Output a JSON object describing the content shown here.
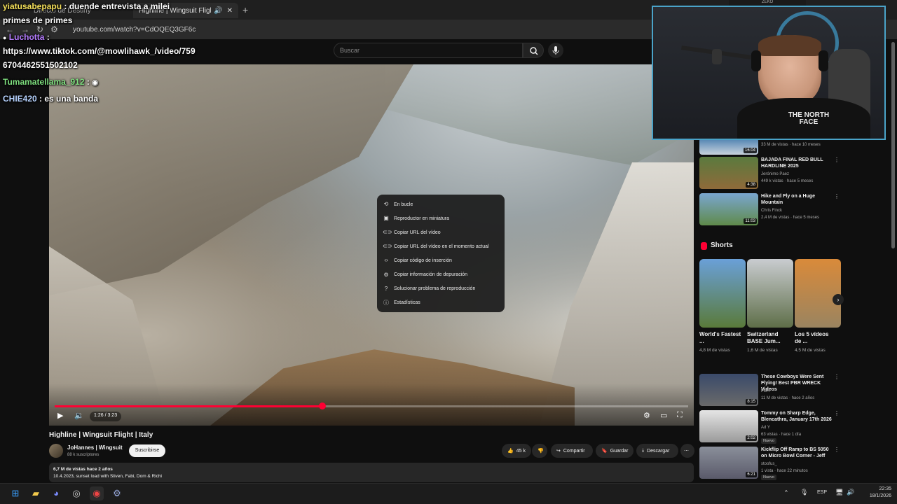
{
  "browser": {
    "tabs": [
      {
        "label": "Directo de Destiny"
      },
      {
        "label": "Highline | Wingsuit Flight | Italy"
      }
    ],
    "url": "youtube.com/watch?v=CdOQEQ3GF6c"
  },
  "header": {
    "search_placeholder": "Buscar"
  },
  "context_menu": {
    "items": [
      {
        "label": "En bucle",
        "icon": "loop-icon"
      },
      {
        "label": "Reproductor en miniatura",
        "icon": "miniplayer-icon"
      },
      {
        "label": "Copiar URL del vídeo",
        "icon": "link-icon"
      },
      {
        "label": "Copiar URL del vídeo en el momento actual",
        "icon": "link-icon"
      },
      {
        "label": "Copiar código de inserción",
        "icon": "embed-icon"
      },
      {
        "label": "Copiar información de depuración",
        "icon": "debug-icon"
      },
      {
        "label": "Solucionar problema de reproducción",
        "icon": "help-icon"
      },
      {
        "label": "Estadísticas",
        "icon": "info-icon"
      }
    ]
  },
  "player": {
    "time": "1:26 / 3:23",
    "progress_fraction": 0.423
  },
  "video": {
    "title": "Highline | Wingsuit Flight | Italy",
    "channel": "JoHannes | Wingsuit",
    "subscribers": "88 k suscriptores",
    "subscribe_label": "Suscribirse",
    "likes": "45 k",
    "share_label": "Compartir",
    "save_label": "Guardar",
    "download_label": "Descargar",
    "description_line1": "6,7 M de vistas  hace 2 años",
    "description_line2": "10.4.2023, sunset load with Stiven, Fabi, Dom & Richi"
  },
  "sidebar": {
    "top_partial": {
      "meta": "33 M de vistas · hace 10 meses",
      "duration": "16:04"
    },
    "recommendations": [
      {
        "title": "BAJADA FINAL RED BULL HARDLINE 2025",
        "channel": "Jerónimo Paez",
        "meta": "449 k vistas · hace 5 meses",
        "duration": "4:38"
      },
      {
        "title": "Hike and Fly on a Huge Mountain",
        "channel": "Chris Finck",
        "meta": "2,4 M de vistas · hace 5 meses",
        "duration": "11:03"
      }
    ],
    "shorts_heading": "Shorts",
    "shorts": [
      {
        "title": "World's Fastest ...",
        "views": "4,8 M de vistas"
      },
      {
        "title": "Switzerland BASE Jum...",
        "views": "1,6 M de vistas"
      },
      {
        "title": "Los 5 vídeos de ...",
        "views": "4,5 M de vistas"
      }
    ],
    "recommendations2": [
      {
        "title": "These Cowboys Were Sent Flying! Best PBR WRECK Videos",
        "channel": "PBR",
        "meta": "11 M de vistas · hace 2 años",
        "duration": "8:15",
        "badge": ""
      },
      {
        "title": "Tommy on Sharp Edge, Blencathra, January 17th 2026",
        "channel": "Ad Y",
        "meta": "63 vistas · hace 1 día",
        "duration": "2:02",
        "badge": "Nuevo"
      },
      {
        "title": "Kickflip Off Ramp to BS 5050 on Micro Bowl Corner - Jeff",
        "channel": "stoofus_",
        "meta": "1 vista · hace 22 minutos",
        "duration": "6:21",
        "badge": "Nuevo"
      }
    ]
  },
  "chat": {
    "line1_user": "yiatusabepapu",
    "line1_msg": ": duende entrevista a milei",
    "line2": "primes de primes",
    "line3_user": "Luchotta",
    "line3_msg": ":",
    "line4": "https://www.tiktok.com/@mowlihawk_/video/759",
    "line5": "6704462551502102",
    "line6_user": "Tumamatellama_912",
    "line6_msg": ":",
    "line7_user": "CHIE420",
    "line7_msg": ": es una banda"
  },
  "webcam": {
    "label": "ZEKO",
    "shirt_text": "THE NORTH FACE"
  },
  "taskbar": {
    "lang": "ESP",
    "time": "22:35",
    "date": "18/1/2026"
  },
  "colors": {
    "accent": "#ff0033",
    "chat_luchotta": "#b57cff",
    "chat_tumama": "#7fe07f",
    "chat_chie": "#b7d3ff"
  }
}
